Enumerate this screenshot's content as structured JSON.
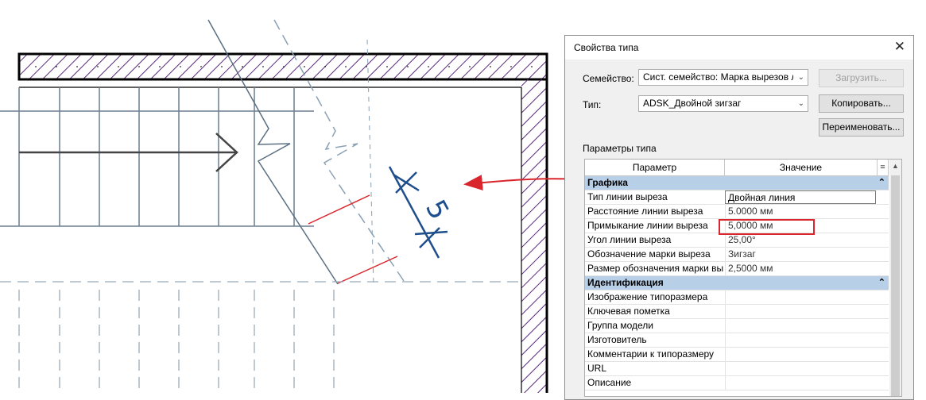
{
  "dialog": {
    "title": "Свойства типа",
    "family_label": "Семейство:",
    "family_value": "Сист. семейство: Марка вырезов лес",
    "load_button": "Загрузить...",
    "type_label": "Тип:",
    "type_value": "ADSK_Двойной зигзаг",
    "copy_button": "Копировать...",
    "rename_button": "Переименовать...",
    "params_label": "Параметры типа",
    "grid": {
      "header_param": "Параметр",
      "header_value": "Значение",
      "header_eq": "=",
      "groups": [
        {
          "name": "Графика",
          "rows": [
            {
              "param": "Тип линии выреза",
              "value": "Двойная линия"
            },
            {
              "param": "Расстояние линии выреза",
              "value": "5.0000 мм"
            },
            {
              "param": "Примыкание линии выреза",
              "value": "5,0000 мм"
            },
            {
              "param": "Угол линии выреза",
              "value": "25,00°"
            },
            {
              "param": "Обозначение марки выреза",
              "value": "Зигзаг"
            },
            {
              "param": "Размер обозначения марки вы",
              "value": "2,5000 мм"
            }
          ]
        },
        {
          "name": "Идентификация",
          "rows": [
            {
              "param": "Изображение типоразмера",
              "value": ""
            },
            {
              "param": "Ключевая пометка",
              "value": ""
            },
            {
              "param": "Группа модели",
              "value": ""
            },
            {
              "param": "Изготовитель",
              "value": ""
            },
            {
              "param": "Комментарии к типоразмеру",
              "value": ""
            },
            {
              "param": "URL",
              "value": ""
            },
            {
              "param": "Описание",
              "value": ""
            }
          ]
        }
      ]
    }
  },
  "drawing": {
    "dimension_text": "5"
  },
  "icons": {
    "close": "close-icon",
    "dropdown": "chevron-down-icon",
    "collapse": "double-chevron-up-icon"
  },
  "colors": {
    "accent_red": "#d9262c",
    "dimension_blue": "#1f4e8c",
    "group_header": "#b8cfe8"
  }
}
